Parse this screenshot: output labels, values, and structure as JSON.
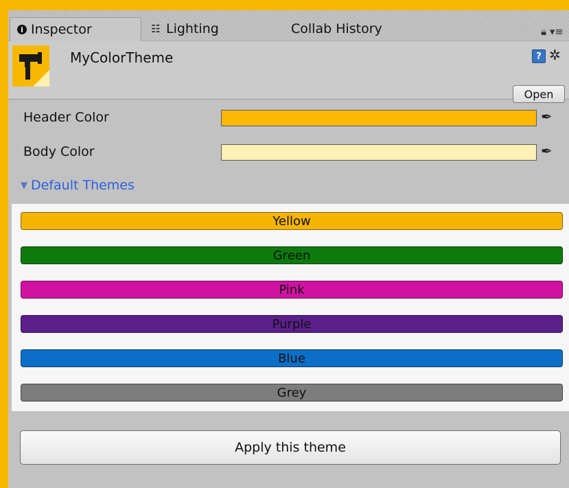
{
  "tabs": [
    {
      "label": "Inspector",
      "icon": "info-icon"
    },
    {
      "label": "Lighting",
      "icon": "lighting-icon"
    },
    {
      "label": "Collab History"
    }
  ],
  "asset": {
    "title": "MyColorTheme",
    "open_label": "Open"
  },
  "properties": {
    "header_color": {
      "label": "Header Color",
      "value": "#fbb903"
    },
    "body_color": {
      "label": "Body Color",
      "value": "#fff0b3"
    }
  },
  "default_themes": {
    "label": "Default Themes",
    "items": [
      {
        "label": "Yellow",
        "color": "#f5b400"
      },
      {
        "label": "Green",
        "color": "#0e7a0e"
      },
      {
        "label": "Pink",
        "color": "#d012a2"
      },
      {
        "label": "Purple",
        "color": "#5b1f8c"
      },
      {
        "label": "Blue",
        "color": "#0b6fc7"
      },
      {
        "label": "Grey",
        "color": "#7d7d7d"
      }
    ]
  },
  "apply_label": "Apply this theme",
  "colors": {
    "frame": "#f8b800",
    "panel": "#c2c2c2",
    "link": "#2a5fe0"
  }
}
